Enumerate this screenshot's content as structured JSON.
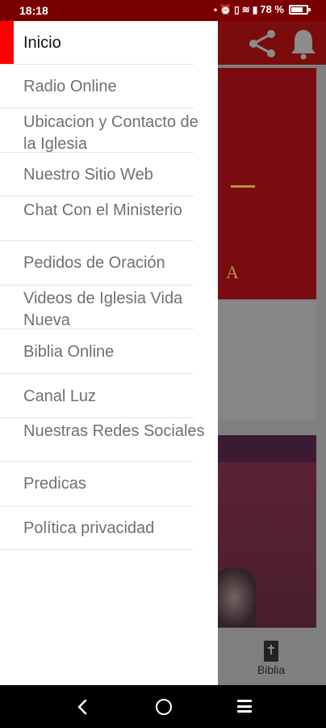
{
  "status_bar": {
    "time": "18:18",
    "battery_percent": "78 %",
    "battery_level": 0.78,
    "icons": [
      "dot-icon",
      "alarm-icon",
      "vibrate-icon",
      "wifi-icon",
      "signal-icon",
      "battery-icon"
    ]
  },
  "colors": {
    "toolbar": "#7a0c0c",
    "active_indicator": "#ff0000",
    "menu_text": "#707070",
    "active_text": "#111111"
  },
  "toolbar": {
    "icons": [
      "share-icon",
      "bell-icon"
    ]
  },
  "drawer": {
    "items": [
      {
        "label": "Inicio",
        "active": true
      },
      {
        "label": "Radio Online"
      },
      {
        "label": "Ubicacion y Contacto de la Iglesia"
      },
      {
        "label": "Nuestro Sitio Web"
      },
      {
        "label": "Chat Con el Ministerio"
      },
      {
        "label": "Pedidos de Oración"
      },
      {
        "label": "Videos de Iglesia Vida Nueva"
      },
      {
        "label": "Biblia Online"
      },
      {
        "label": "Canal Luz"
      },
      {
        "label": "Nuestras Redes Sociales"
      },
      {
        "label": "Predicas"
      },
      {
        "label": "Política privacidad"
      }
    ]
  },
  "background": {
    "banner_letter": "A",
    "bottom_tab_label": "Biblia"
  },
  "nav_bar": {
    "icons": [
      "back-icon",
      "home-icon",
      "recent-apps-icon"
    ]
  }
}
